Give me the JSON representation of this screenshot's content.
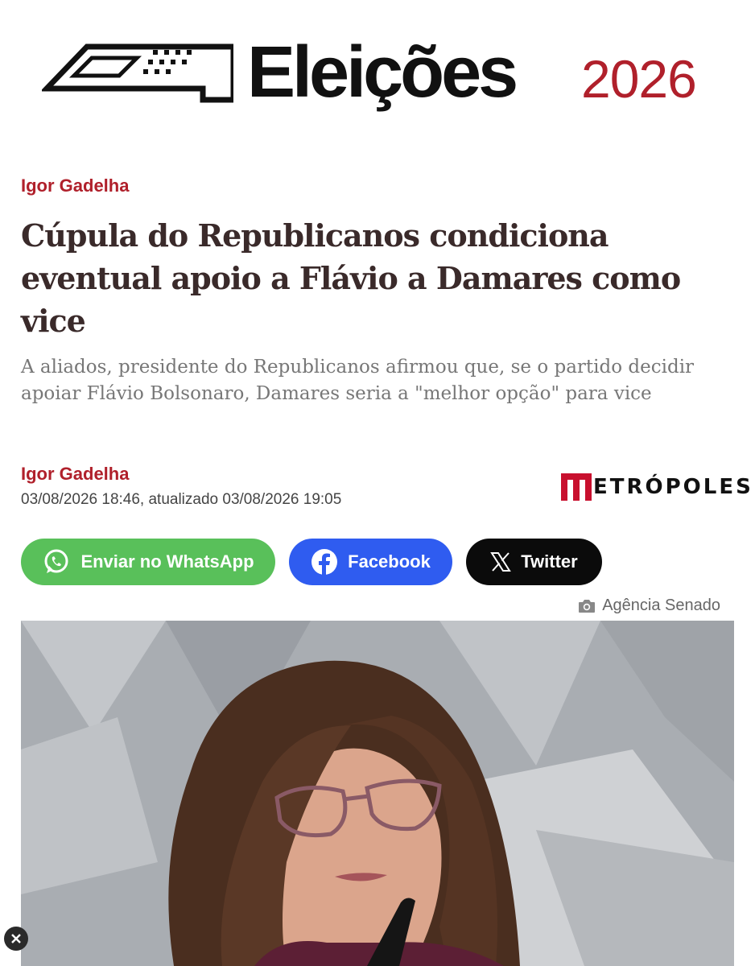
{
  "banner": {
    "title": "Eleições",
    "year": "2026"
  },
  "byline_top": "Igor Gadelha",
  "headline": "Cúpula do Republicanos condiciona eventual apoio a Flávio a Damares como vice",
  "subtitle": "A aliados, presidente do Republicanos afirmou que, se o partido decidir apoiar Flávio Bolsonaro, Damares seria a \"melhor opção\" para vice",
  "author": "Igor Gadelha",
  "dates": "03/08/2026 18:46, atualizado 03/08/2026 19:05",
  "publisher_logo": "ETRÓPOLES",
  "share": {
    "whatsapp": "Enviar no WhatsApp",
    "facebook": "Facebook",
    "twitter": "Twitter"
  },
  "photo_credit": "Agência Senado",
  "colors": {
    "accent_red": "#b0202b",
    "whatsapp_green": "#59c05a",
    "facebook_blue": "#2f5cf0",
    "twitter_black": "#0b0b0b"
  },
  "icons": [
    "ballot-icon",
    "whatsapp-icon",
    "facebook-icon",
    "x-icon",
    "camera-icon",
    "close-icon"
  ]
}
